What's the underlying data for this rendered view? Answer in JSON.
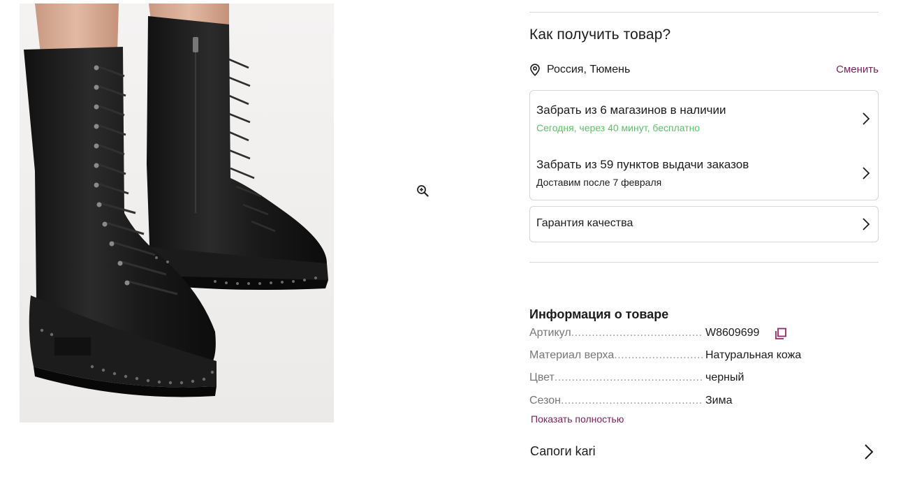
{
  "delivery": {
    "title": "Как получить товар?",
    "location": "Россия, Тюмень",
    "change_label": "Сменить",
    "options": [
      {
        "title": "Забрать из 6 магазинов в наличии",
        "subtitle": "Сегодня, через 40 минут, бесплатно",
        "subtitle_color": "#5dc168"
      },
      {
        "title": "Забрать из 59 пунктов выдачи заказов",
        "subtitle": "Доставим после 7 февраля",
        "subtitle_color": "#1c1c1c"
      }
    ],
    "warranty": "Гарантия качества"
  },
  "info": {
    "title": "Информация о товаре",
    "specs": [
      {
        "key": "Артикул",
        "value": "W8609699"
      },
      {
        "key": "Материал верха",
        "value": "Натуральная кожа"
      },
      {
        "key": "Цвет",
        "value": "черный"
      },
      {
        "key": "Сезон",
        "value": "Зима"
      }
    ],
    "show_all": "Показать полностью"
  },
  "brand": {
    "label": "Сапоги kari"
  },
  "icons": {
    "zoom": "zoom-in-icon",
    "location": "map-pin-icon",
    "chevron": "chevron-right-icon",
    "copy": "copy-icon"
  },
  "colors": {
    "accent": "#7b1f5a",
    "success": "#5dc168",
    "text": "#1c1c1c",
    "muted": "#777777",
    "border": "#d6d6d6"
  }
}
